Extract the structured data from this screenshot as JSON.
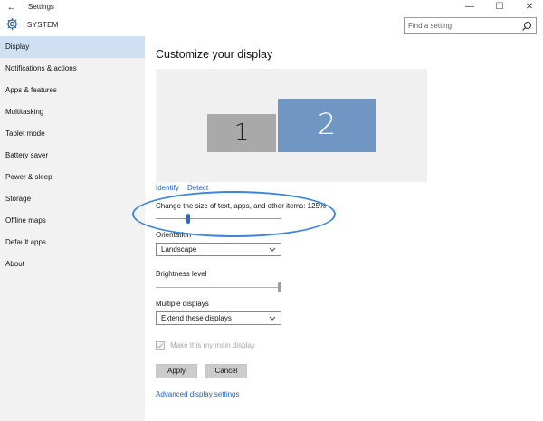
{
  "window": {
    "title": "Settings",
    "back_icon": "back-arrow-icon",
    "minimize": "—",
    "maximize": "☐",
    "close": "✕"
  },
  "header": {
    "section_title": "SYSTEM",
    "section_icon": "gear-icon",
    "search_placeholder": "Find a setting",
    "search_icon": "search-icon"
  },
  "sidebar": {
    "items": [
      {
        "label": "Display",
        "active": true
      },
      {
        "label": "Notifications & actions"
      },
      {
        "label": "Apps & features"
      },
      {
        "label": "Multitasking"
      },
      {
        "label": "Tablet mode"
      },
      {
        "label": "Battery saver"
      },
      {
        "label": "Power & sleep"
      },
      {
        "label": "Storage"
      },
      {
        "label": "Offline maps"
      },
      {
        "label": "Default apps"
      },
      {
        "label": "About"
      }
    ]
  },
  "main": {
    "title": "Customize your display",
    "monitors": [
      {
        "number": "1",
        "selected": false
      },
      {
        "number": "2",
        "selected": true
      }
    ],
    "identify_link": "Identify",
    "detect_link": "Detect",
    "scale_label": "Change the size of text, apps, and other items: 125%",
    "scale_level": 0.25,
    "orientation_label": "Orientation",
    "orientation_value": "Landscape",
    "brightness_label": "Brightness level",
    "brightness_level": 1.0,
    "multiple_displays_label": "Multiple displays",
    "multiple_displays_value": "Extend these displays",
    "main_display_label": "Make this my main display",
    "main_display_checked": true,
    "main_display_disabled": true,
    "apply_label": "Apply",
    "cancel_label": "Cancel",
    "advanced_link": "Advanced display settings"
  },
  "colors": {
    "accent": "#1f5fbf",
    "sidebar_bg": "#f2f2f2",
    "sidebar_active": "#cfe0f2",
    "monitor_selected": "#7097c4",
    "monitor_unselected": "#a9a9a9",
    "annotation_ellipse": "#3d86d6"
  }
}
